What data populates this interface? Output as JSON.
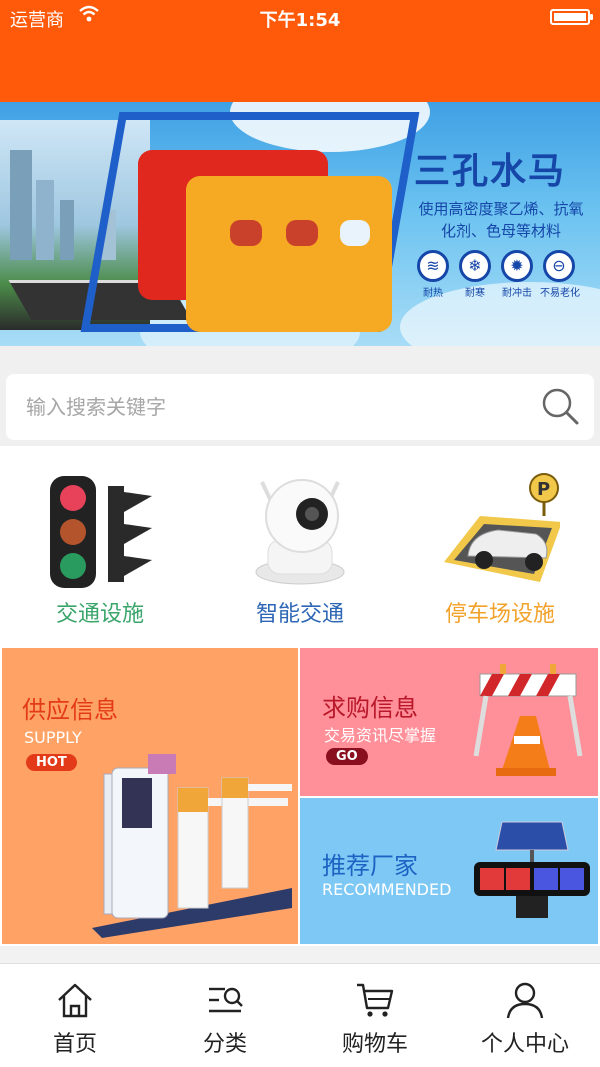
{
  "status_bar": {
    "carrier": "运营商",
    "time": "下午1:54"
  },
  "banner": {
    "title": "三孔水马",
    "subtitle": "使用高密度聚乙烯、抗氧化剂、色母等材料",
    "features": [
      "耐热",
      "耐寒",
      "耐冲击",
      "不易老化"
    ]
  },
  "search": {
    "placeholder": "输入搜索关键字"
  },
  "categories": [
    {
      "label": "交通设施",
      "color": "#3aa56a"
    },
    {
      "label": "智能交通",
      "color": "#2d66b4"
    },
    {
      "label": "停车场设施",
      "color": "#f2a22a"
    }
  ],
  "promo": {
    "supply": {
      "title": "供应信息",
      "subtitle": "SUPPLY",
      "badge": "HOT"
    },
    "demand": {
      "title": "求购信息",
      "subtitle": "交易资讯尽掌握",
      "badge": "GO"
    },
    "recommend": {
      "title": "推荐厂家",
      "subtitle": "RECOMMENDED"
    }
  },
  "tabbar": [
    {
      "label": "首页",
      "icon": "home-icon"
    },
    {
      "label": "分类",
      "icon": "category-search-icon"
    },
    {
      "label": "购物车",
      "icon": "cart-icon"
    },
    {
      "label": "个人中心",
      "icon": "user-icon"
    }
  ],
  "colors": {
    "header": "#ff5a0a",
    "banner_text": "#1546a8",
    "supply_bg": "#ffa266",
    "demand_bg": "#ff8f98",
    "recommend_bg": "#7ec8f5"
  }
}
